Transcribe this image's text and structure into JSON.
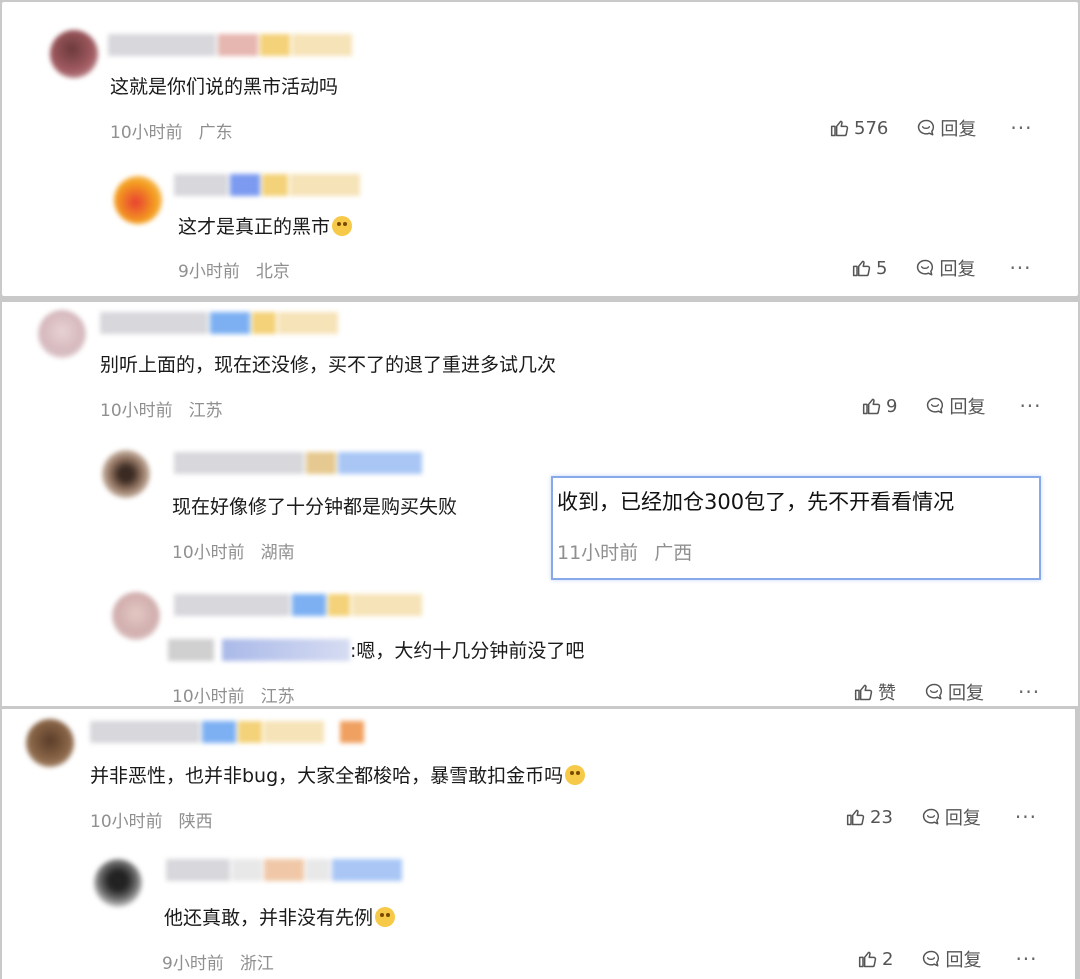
{
  "comments": [
    {
      "text": "这就是你们说的黑市活动吗",
      "time": "10小时前",
      "location": "广东",
      "likes": "576",
      "reply_label": "回复",
      "more": "···"
    },
    {
      "text": "这才是真正的黑市",
      "time": "9小时前",
      "location": "北京",
      "likes": "5",
      "reply_label": "回复",
      "more": "···"
    },
    {
      "text": "别听上面的，现在还没修，买不了的退了重进多试几次",
      "time": "10小时前",
      "location": "江苏",
      "likes": "9",
      "reply_label": "回复",
      "more": "···"
    },
    {
      "text": "现在好像修了十分钟都是购买失败",
      "time": "10小时前",
      "location": "湖南"
    },
    {
      "text": ":嗯，大约十几分钟前没了吧",
      "time": "10小时前",
      "location": "江苏",
      "likes": "赞",
      "reply_label": "回复",
      "more": "···"
    },
    {
      "text": "并非恶性，也并非bug，大家全都梭哈，暴雪敢扣金币吗",
      "time": "10小时前",
      "location": "陕西",
      "likes": "23",
      "reply_label": "回复",
      "more": "···"
    },
    {
      "text": "他还真敢，并非没有先例",
      "time": "9小时前",
      "location": "浙江",
      "likes": "2",
      "reply_label": "回复",
      "more": "···"
    }
  ],
  "popup": {
    "text": "收到，已经加仓300包了，先不开看看情况",
    "time": "11小时前",
    "location": "广西"
  },
  "colors": {
    "meta": "#8f8f8f",
    "popup_border": "#86a9ea",
    "panel_bg": "#ffffff"
  },
  "icons": {
    "like": "thumbs-up-icon",
    "reply": "speech-bubble-icon",
    "more": "more-dots-icon"
  }
}
